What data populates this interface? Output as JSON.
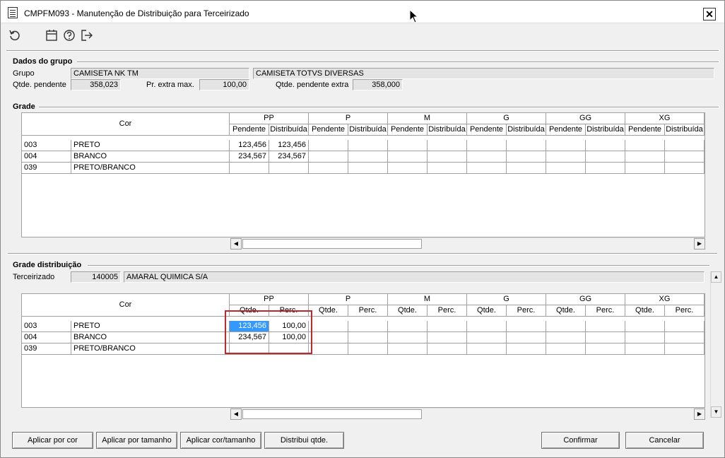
{
  "window": {
    "title": "CMPFM093 - Manutenção de Distribuição para Terceirizado",
    "close_label": "✕"
  },
  "toolbar": {
    "icons": [
      "refresh-icon",
      "calendar-icon",
      "help-icon",
      "exit-icon"
    ]
  },
  "dados_grupo": {
    "title": "Dados do grupo",
    "grupo_label": "Grupo",
    "grupo_value": "CAMISETA NK TM",
    "grupo_desc": "CAMISETA TOTVS DIVERSAS",
    "qtde_pendente_label": "Qtde. pendente",
    "qtde_pendente_value": "358,023",
    "pr_extra_label": "Pr. extra max.",
    "pr_extra_value": "100,00",
    "qtde_pendente_extra_label": "Qtde. pendente extra",
    "qtde_pendente_extra_value": "358,000"
  },
  "grade": {
    "title": "Grade",
    "cor_header": "Cor",
    "sizes": [
      "PP",
      "P",
      "M",
      "G",
      "GG",
      "XG"
    ],
    "sub_headers": [
      "Pendente",
      "Distribuída"
    ],
    "rows": [
      {
        "code": "003",
        "name": "PRETO",
        "pp_pend": "123,456",
        "pp_dist": "123,456"
      },
      {
        "code": "004",
        "name": "BRANCO",
        "pp_pend": "234,567",
        "pp_dist": "234,567"
      },
      {
        "code": "039",
        "name": "PRETO/BRANCO",
        "pp_pend": "",
        "pp_dist": ""
      }
    ]
  },
  "grade_distribuicao": {
    "title": "Grade distribuição",
    "terceirizado_label": "Terceirizado",
    "terceirizado_code": "140005",
    "terceirizado_name": "AMARAL QUIMICA S/A",
    "cor_header": "Cor",
    "sizes": [
      "PP",
      "P",
      "M",
      "G",
      "GG",
      "XG"
    ],
    "sub_headers": [
      "Qtde.",
      "Perc."
    ],
    "rows": [
      {
        "code": "003",
        "name": "PRETO",
        "pp_qtde": "123,456",
        "pp_perc": "100,00"
      },
      {
        "code": "004",
        "name": "BRANCO",
        "pp_qtde": "234,567",
        "pp_perc": "100,00"
      },
      {
        "code": "039",
        "name": "PRETO/BRANCO",
        "pp_qtde": "",
        "pp_perc": ""
      }
    ]
  },
  "buttons": {
    "aplicar_cor": "Aplicar por cor",
    "aplicar_tamanho": "Aplicar por tamanho",
    "aplicar_cor_tamanho": "Aplicar cor/tamanho",
    "distribui_qtde": "Distribui qtde.",
    "confirmar": "Confirmar",
    "cancelar": "Cancelar"
  },
  "colors": {
    "highlight_border": "#c0282d",
    "selection": "#3399ff"
  }
}
